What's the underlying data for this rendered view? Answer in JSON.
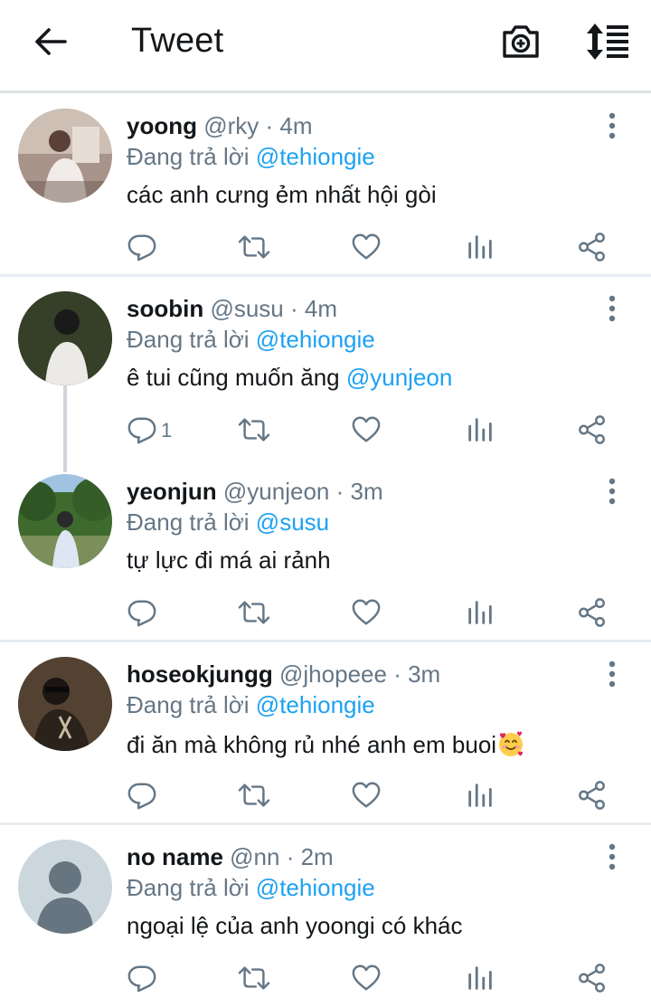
{
  "header": {
    "title": "Tweet",
    "back_icon": "arrow-left-icon",
    "camera_icon": "camera-plus-icon",
    "sort_icon": "sort-list-icon"
  },
  "colors": {
    "link": "#1da1f2",
    "secondary": "#657786",
    "primary": "#14171a",
    "divider": "#e6ecf0"
  },
  "tweets": [
    {
      "name": "yoong",
      "handle": "@rky",
      "time": "· 4m",
      "reply_prefix": "Đang trả lời",
      "reply_to": "@tehiongie",
      "text": "các anh cưng ẻm nhất hội gòi",
      "text_mention": "",
      "reply_count": ""
    },
    {
      "name": "soobin",
      "handle": "@susu",
      "time": "· 4m",
      "reply_prefix": "Đang trả lời",
      "reply_to": "@tehiongie",
      "text": "ê tui cũng muốn ăng",
      "text_mention": "@yunjeon",
      "reply_count": "1"
    },
    {
      "name": "yeonjun",
      "handle": "@yunjeon",
      "time": "· 3m",
      "reply_prefix": "Đang trả lời",
      "reply_to": "@susu",
      "text": "tự lực đi má ai rảnh",
      "text_mention": "",
      "reply_count": ""
    },
    {
      "name": "hoseokjungg",
      "handle": "@jhopeee",
      "time": "· 3m",
      "reply_prefix": "Đang trả lời",
      "reply_to": "@tehiongie",
      "text": "đi ăn mà không rủ nhé anh em buoi",
      "text_mention": "",
      "reply_count": "",
      "emoji": "smiling-face-with-hearts"
    },
    {
      "name": "no name",
      "handle": "@nn",
      "time": "· 2m",
      "reply_prefix": "Đang trả lời",
      "reply_to": "@tehiongie",
      "text": "ngoại lệ của anh yoongi có khác",
      "text_mention": "",
      "reply_count": ""
    }
  ]
}
